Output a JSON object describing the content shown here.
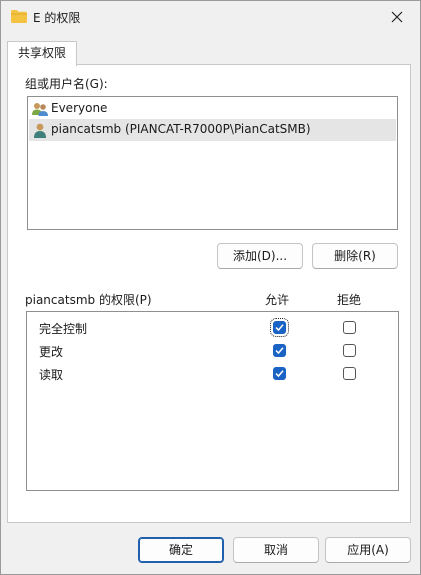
{
  "window": {
    "title": "E 的权限"
  },
  "tabs": [
    {
      "label": "共享权限"
    }
  ],
  "groups": {
    "label": "组或用户名(G):",
    "items": [
      {
        "label": "Everyone",
        "icon": "users-group-icon",
        "selected": false
      },
      {
        "label": "piancatsmb (PIANCAT-R7000P\\PianCatSMB)",
        "icon": "user-icon",
        "selected": true
      }
    ],
    "add_label": "添加(D)...",
    "remove_label": "删除(R)"
  },
  "permissions": {
    "label": "piancatsmb 的权限(P)",
    "allow_header": "允许",
    "deny_header": "拒绝",
    "rows": [
      {
        "name": "完全控制",
        "allow": true,
        "deny": false
      },
      {
        "name": "更改",
        "allow": true,
        "deny": false
      },
      {
        "name": "读取",
        "allow": true,
        "deny": false
      }
    ]
  },
  "footer": {
    "ok_label": "确定",
    "cancel_label": "取消",
    "apply_label": "应用(A)"
  },
  "colors": {
    "accent": "#1a62c4",
    "folder": "#f5c342",
    "selection": "#e5e5e5"
  }
}
